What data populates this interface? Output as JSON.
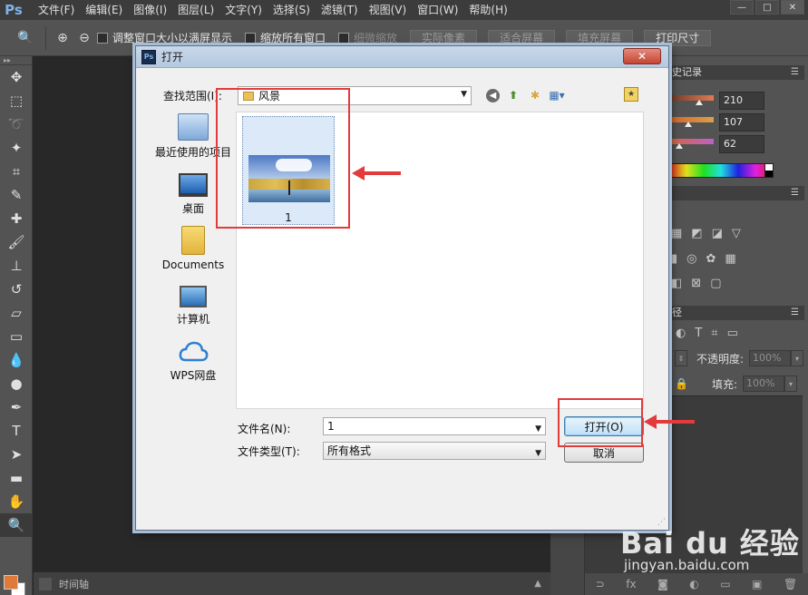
{
  "ps": {
    "logo": "Ps",
    "menu": [
      "文件(F)",
      "编辑(E)",
      "图像(I)",
      "图层(L)",
      "文字(Y)",
      "选择(S)",
      "滤镜(T)",
      "视图(V)",
      "窗口(W)",
      "帮助(H)"
    ],
    "window_buttons": [
      "—",
      "□",
      "✕"
    ]
  },
  "options": {
    "resize_windows": "调整窗口大小以满屏显示",
    "zoom_all": "缩放所有窗口",
    "scrubby": "细微缩放",
    "actual_pixels": "实际像素",
    "fit_screen": "适合屏幕",
    "fill_screen": "填充屏幕",
    "print_size": "打印尺寸"
  },
  "timeline": {
    "label": "时间轴"
  },
  "panels": {
    "history_head": "史记录",
    "rgb_values": [
      "210",
      "107",
      "62"
    ],
    "paths_head": "径",
    "opacity_label": "不透明度:",
    "opacity_value": "100%",
    "fill_label": "填充:",
    "fill_value": "100%"
  },
  "dialog": {
    "title": "打开",
    "look_in_label": "查找范围(I):",
    "look_in_value": "风景",
    "places": [
      {
        "label": "最近使用的项目"
      },
      {
        "label": "桌面"
      },
      {
        "label": "Documents"
      },
      {
        "label": "计算机"
      },
      {
        "label": "WPS网盘"
      }
    ],
    "file": {
      "name": "1"
    },
    "filename_label": "文件名(N):",
    "filename_value": "1",
    "filetype_label": "文件类型(T):",
    "filetype_value": "所有格式",
    "open_button": "打开(O)",
    "cancel_button": "取消"
  },
  "watermark": {
    "brand": "Bai du 经验",
    "url": "jingyan.baidu.com"
  },
  "colors": {
    "annotation_red": "#e23b3b",
    "foreground_swatch": "#e07a3a"
  }
}
